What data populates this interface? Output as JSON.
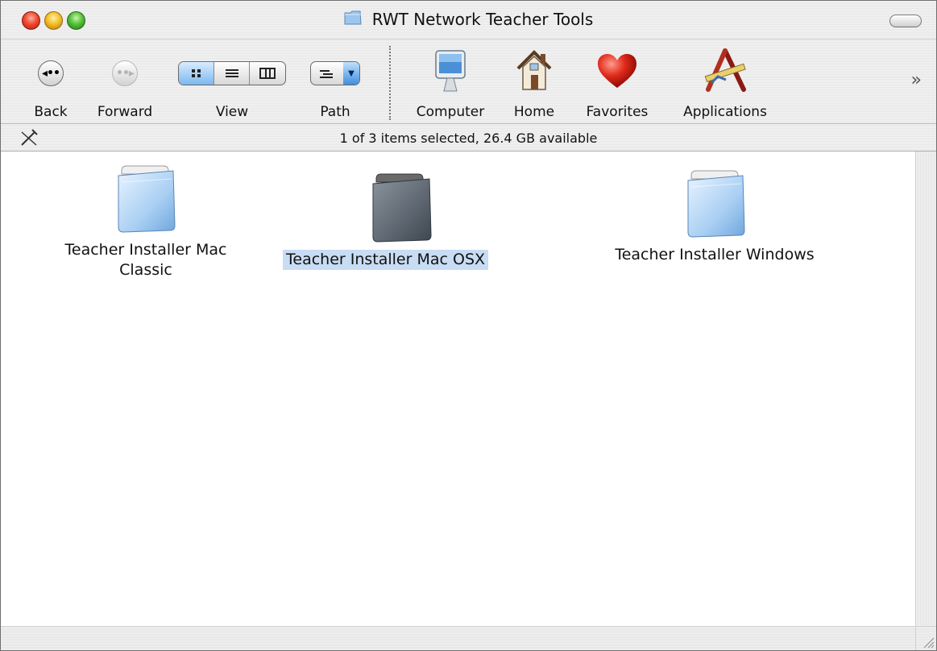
{
  "window": {
    "title": "RWT Network Teacher Tools"
  },
  "toolbar": {
    "back_label": "Back",
    "forward_label": "Forward",
    "view_label": "View",
    "path_label": "Path",
    "computer_label": "Computer",
    "home_label": "Home",
    "favorites_label": "Favorites",
    "applications_label": "Applications",
    "view_modes": [
      "icon",
      "list",
      "column"
    ],
    "active_view_mode": "icon",
    "overflow_glyph": "»"
  },
  "status": {
    "text": "1 of 3 items selected, 26.4 GB available"
  },
  "files": [
    {
      "line1": "Teacher Installer Mac",
      "line2": "Classic",
      "selected": false
    },
    {
      "line1": "Teacher Installer Mac OSX",
      "line2": "",
      "selected": true
    },
    {
      "line1": "Teacher Installer Windows",
      "line2": "",
      "selected": false
    }
  ],
  "colors": {
    "selection_highlight": "#c8dcf3",
    "close_button": "#f04a32",
    "minimize_button": "#f5bf2a",
    "zoom_button": "#55c23c",
    "folder_blue": "#9cc6ee",
    "folder_selected": "#5d6670"
  }
}
